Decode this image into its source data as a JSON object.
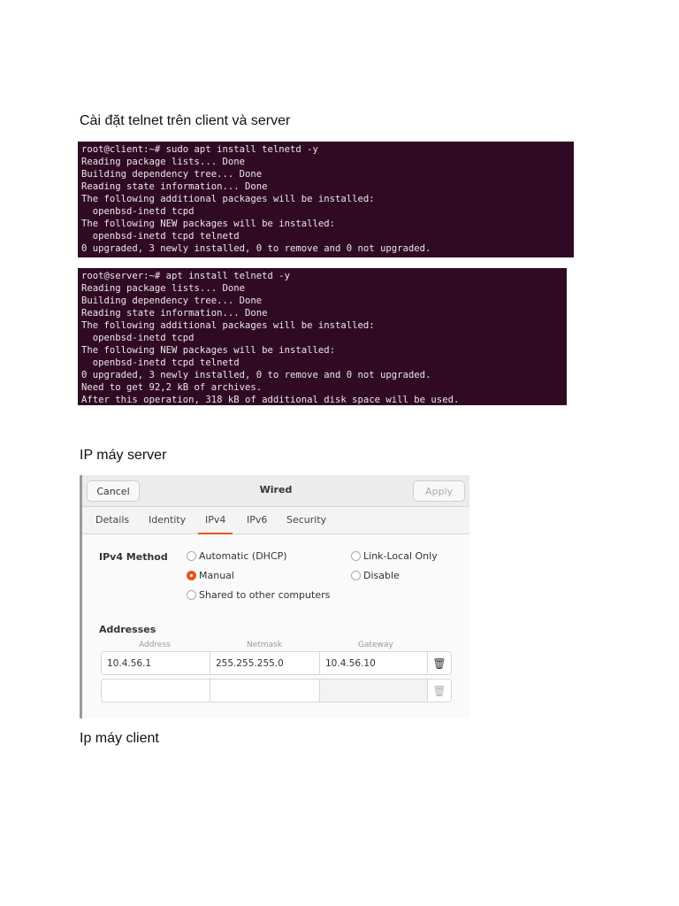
{
  "headings": {
    "install": "Cài đặt telnet trên client và server",
    "server_ip": "IP máy server",
    "client_ip": "Ip máy client"
  },
  "terminal_client": {
    "lines": [
      "root@client:~# sudo apt install telnetd -y",
      "Reading package lists... Done",
      "Building dependency tree... Done",
      "Reading state information... Done",
      "The following additional packages will be installed:",
      "  openbsd-inetd tcpd",
      "The following NEW packages will be installed:",
      "  openbsd-inetd tcpd telnetd",
      "0 upgraded, 3 newly installed, 0 to remove and 0 not upgraded."
    ]
  },
  "terminal_server": {
    "lines": [
      "root@server:~# apt install telnetd -y",
      "Reading package lists... Done",
      "Building dependency tree... Done",
      "Reading state information... Done",
      "The following additional packages will be installed:",
      "  openbsd-inetd tcpd",
      "The following NEW packages will be installed:",
      "  openbsd-inetd tcpd telnetd",
      "0 upgraded, 3 newly installed, 0 to remove and 0 not upgraded.",
      "Need to get 92,2 kB of archives.",
      "After this operation, 318 kB of additional disk space will be used."
    ]
  },
  "dialog": {
    "cancel": "Cancel",
    "title": "Wired",
    "apply": "Apply",
    "tabs": [
      "Details",
      "Identity",
      "IPv4",
      "IPv6",
      "Security"
    ],
    "active_tab": "IPv4",
    "method_label": "IPv4 Method",
    "methods": {
      "auto": "Automatic (DHCP)",
      "manual": "Manual",
      "shared": "Shared to other computers",
      "link_local": "Link-Local Only",
      "disable": "Disable"
    },
    "selected_method": "Manual",
    "addresses_label": "Addresses",
    "columns": [
      "Address",
      "Netmask",
      "Gateway"
    ],
    "rows": [
      {
        "address": "10.4.56.1",
        "netmask": "255.255.255.0",
        "gateway": "10.4.56.10"
      },
      {
        "address": "",
        "netmask": "",
        "gateway": ""
      }
    ],
    "accent": "#e95420"
  }
}
